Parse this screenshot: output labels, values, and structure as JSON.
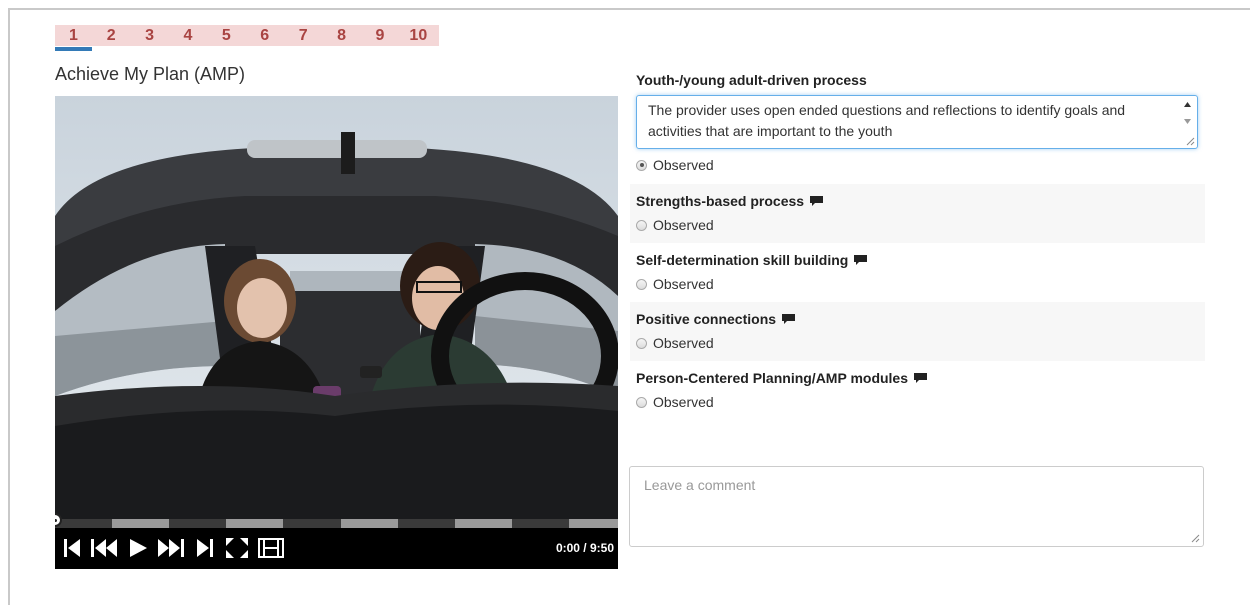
{
  "pages": [
    "1",
    "2",
    "3",
    "4",
    "5",
    "6",
    "7",
    "8",
    "9",
    "10"
  ],
  "active_page": "1",
  "video_title": "Achieve My Plan (AMP)",
  "player": {
    "time": "0:00 / 9:50",
    "progress": 0
  },
  "criteria": [
    {
      "label": "Youth-/young adult-driven process",
      "has_comment_icon": false,
      "comment_text": "The provider uses open ended questions and reflections to identify goals and activities that are important to the youth",
      "option": "Observed",
      "checked": true
    },
    {
      "label": "Strengths-based process",
      "has_comment_icon": true,
      "option": "Observed",
      "checked": false
    },
    {
      "label": "Self-determination skill building",
      "has_comment_icon": true,
      "option": "Observed",
      "checked": false
    },
    {
      "label": "Positive connections",
      "has_comment_icon": true,
      "option": "Observed",
      "checked": false
    },
    {
      "label": "Person-Centered Planning/AMP modules",
      "has_comment_icon": true,
      "option": "Observed",
      "checked": false
    }
  ],
  "comment_placeholder": "Leave a comment",
  "colors": {
    "tab_bg": "#f4d7d7",
    "tab_text": "#a94442",
    "active_underline": "#337ab7",
    "focus_border": "#66afe9"
  }
}
